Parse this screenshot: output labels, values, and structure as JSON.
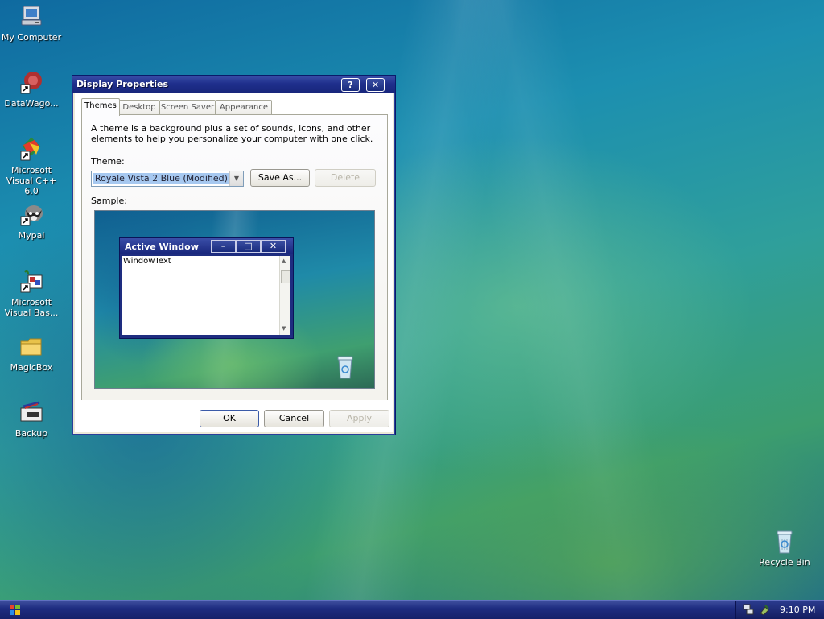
{
  "desktop": {
    "icons": [
      {
        "label": "My Computer"
      },
      {
        "label": "DataWago..."
      },
      {
        "label": "Microsoft Visual C++ 6.0"
      },
      {
        "label": "Mypal"
      },
      {
        "label": "Microsoft Visual Bas..."
      },
      {
        "label": "MagicBox"
      },
      {
        "label": "Backup"
      },
      {
        "label": "Recycle Bin"
      }
    ]
  },
  "dialog": {
    "title": "Display Properties",
    "help_label": "?",
    "close_label": "✕",
    "tabs": [
      {
        "label": "Themes"
      },
      {
        "label": "Desktop"
      },
      {
        "label": "Screen Saver"
      },
      {
        "label": "Appearance"
      }
    ],
    "description": "A theme is a background plus a set of sounds, icons, and other elements to help you personalize your computer with one click.",
    "theme_label": "Theme:",
    "theme_value": "Royale Vista 2 Blue (Modified)",
    "save_as_label": "Save As...",
    "delete_label": "Delete",
    "sample_label": "Sample:",
    "preview": {
      "window_title": "Active Window",
      "window_text": "WindowText"
    },
    "ok_label": "OK",
    "cancel_label": "Cancel",
    "apply_label": "Apply"
  },
  "taskbar": {
    "clock": "9:10 PM"
  },
  "colors": {
    "titlebar": "#1f2f8c",
    "dialog_bg": "#ece9d8",
    "selection": "#a6c8f0"
  }
}
